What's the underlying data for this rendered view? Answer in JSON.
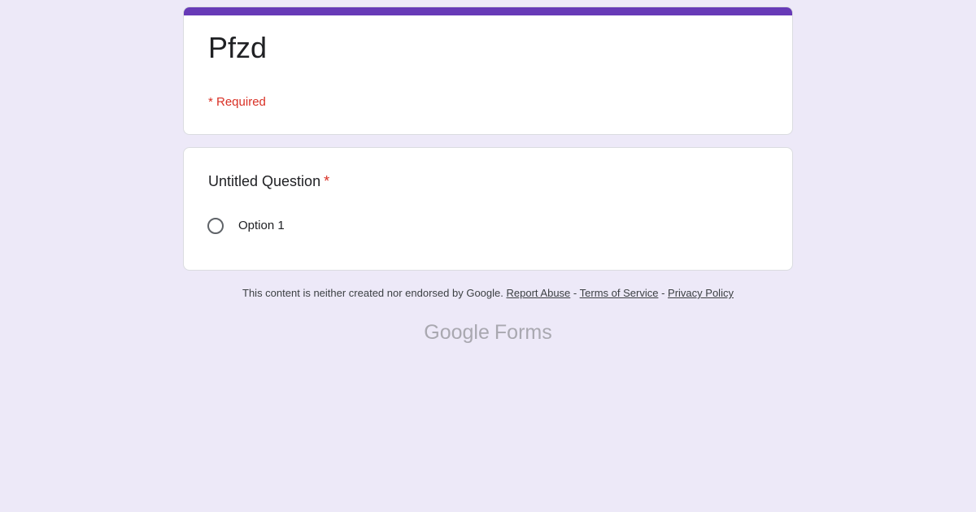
{
  "form": {
    "title": "Pfzd",
    "required_note": "* Required",
    "accent_color": "#673ab7"
  },
  "question": {
    "title": "Untitled Question",
    "required_marker": "*",
    "options": [
      {
        "label": "Option 1",
        "selected": false
      }
    ]
  },
  "footer": {
    "disclaimer": "This content is neither created nor endorsed by Google.",
    "report_abuse": "Report Abuse",
    "separator_1": "-",
    "terms": "Terms of Service",
    "separator_2": "-",
    "privacy": "Privacy Policy"
  },
  "branding": {
    "google": "Google",
    "product": "Forms"
  }
}
